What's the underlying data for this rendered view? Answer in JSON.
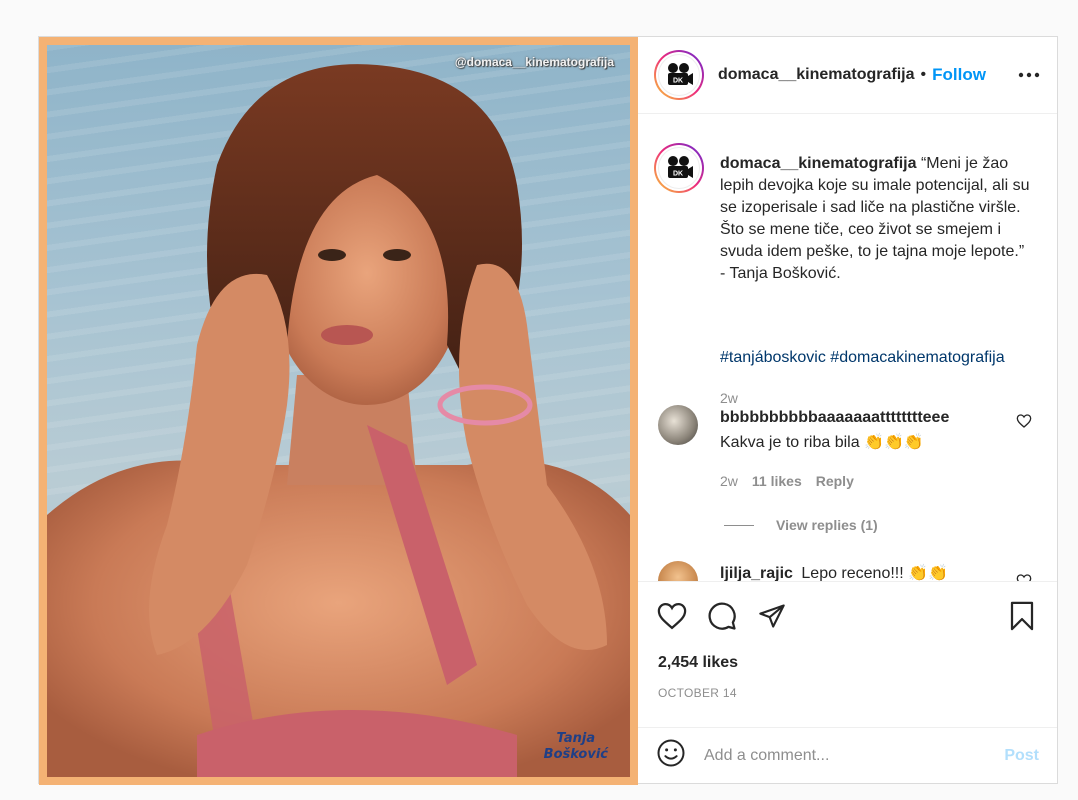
{
  "post": {
    "photo": {
      "watermark": "@domaca__kinematografija",
      "credit_line1": "Tanja",
      "credit_line2": "Bošković"
    },
    "header": {
      "username": "domaca__kinematografija",
      "separator": "•",
      "follow_label": "Follow",
      "avatar_text": "DK"
    },
    "caption": {
      "username": "domaca__kinematografija",
      "text": " “Meni je žao lepih devojka koje su imale potencijal, ali su se izoperisale i sad liče na plastične viršle. Što se mene tiče, ceo život se smejem i svuda idem peške, to je tajna moje lepote.”\n- Tanja Bošković.",
      "hashtags": "#tanjáboskovic #domacakinematografija",
      "time": "2w"
    },
    "comments": [
      {
        "username": "bbbbbbbbbbaaaaaaatttttttteee",
        "text": "Kakva je to riba bila 👏👏👏",
        "time": "2w",
        "likes": "11 likes",
        "reply_label": "Reply",
        "view_replies": "View replies (1)"
      },
      {
        "username": "ljilja_rajic",
        "text": "Lepo receno!!! 👏👏"
      }
    ],
    "actions": {
      "likes": "2,454 likes",
      "date": "OCTOBER 14"
    },
    "add_comment": {
      "placeholder": "Add a comment...",
      "post_label": "Post"
    },
    "colors": {
      "accent": "#0095f6",
      "frame": "#f4b274",
      "post_disabled": "#b2dffc"
    }
  }
}
